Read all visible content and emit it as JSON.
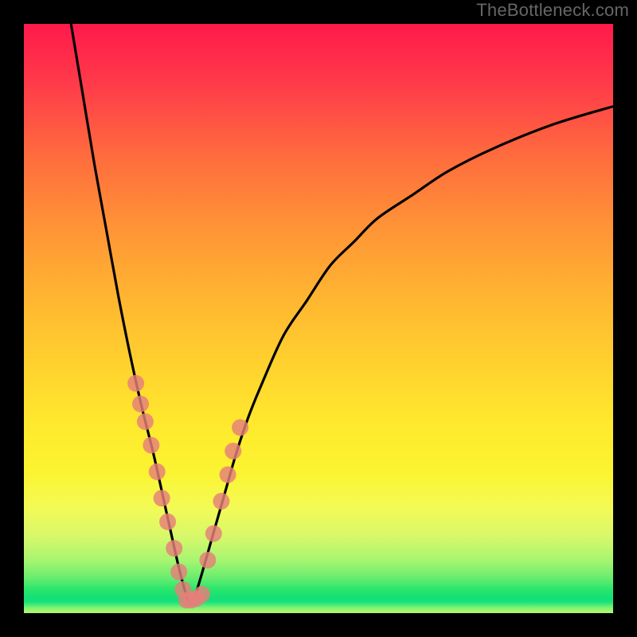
{
  "attribution": "TheBottleneck.com",
  "colors": {
    "border": "#000000",
    "curve": "#000000",
    "dots": "#e57f7a",
    "gradient_stops": [
      "#ff1a4b",
      "#ff6a3e",
      "#ffd22e",
      "#fbf430",
      "#28e66c",
      "#b5f76e"
    ]
  },
  "chart_data": {
    "type": "line",
    "title": "",
    "xlabel": "",
    "ylabel": "",
    "xlim": [
      0,
      100
    ],
    "ylim": [
      0,
      100
    ],
    "grid": false,
    "legend": false,
    "annotations": [
      "TheBottleneck.com"
    ],
    "background": "vertical-heat-gradient-red-to-green",
    "note": "Axes carry no tick labels in the source image; x and y are normalized 0–100. Curve is a sharp V / bottleneck shape with minimum near x≈28. Salmon dots cluster along the lower portion of both arms.",
    "series": [
      {
        "name": "bottleneck-curve",
        "x": [
          8,
          10,
          12,
          14,
          16,
          18,
          20,
          22,
          24,
          26,
          27,
          28,
          29,
          30,
          32,
          34,
          36,
          38,
          40,
          44,
          48,
          52,
          56,
          60,
          66,
          72,
          80,
          90,
          100
        ],
        "y": [
          100,
          88,
          76,
          65,
          54,
          44,
          35,
          27,
          18,
          9,
          5,
          2,
          3,
          6,
          13,
          20,
          27,
          33,
          38,
          47,
          53,
          59,
          63,
          67,
          71,
          75,
          79,
          83,
          86
        ]
      },
      {
        "name": "dots-left-arm",
        "x": [
          19.0,
          19.8,
          20.6,
          21.6,
          22.6,
          23.4,
          24.4,
          25.5,
          26.3,
          27.0
        ],
        "y": [
          39.0,
          35.5,
          32.5,
          28.5,
          24.0,
          19.5,
          15.5,
          11.0,
          7.0,
          4.0
        ]
      },
      {
        "name": "dots-bottom",
        "x": [
          27.6,
          28.4,
          29.3,
          30.2
        ],
        "y": [
          2.2,
          2.2,
          2.5,
          3.2
        ]
      },
      {
        "name": "dots-right-arm",
        "x": [
          31.2,
          32.2,
          33.5,
          34.6,
          35.5,
          36.7
        ],
        "y": [
          9.0,
          13.5,
          19.0,
          23.5,
          27.5,
          31.5
        ]
      }
    ]
  }
}
